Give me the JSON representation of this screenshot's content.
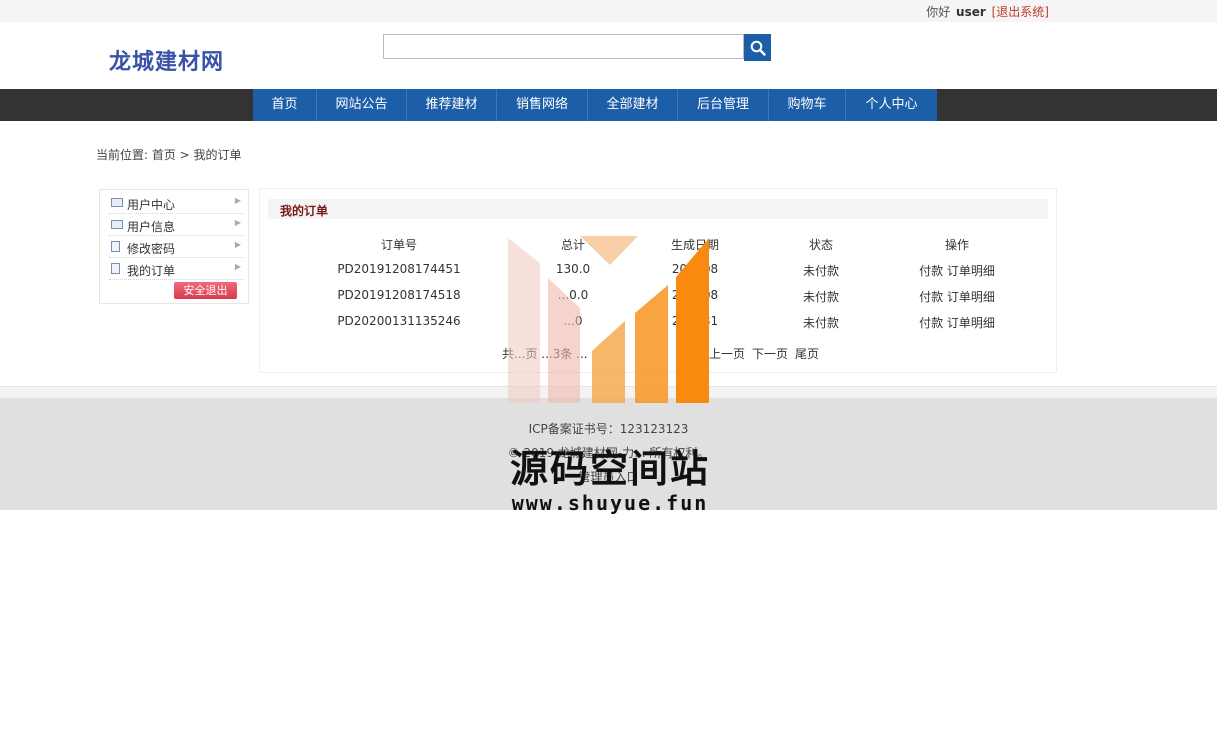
{
  "topbar": {
    "greeting": "你好",
    "username": "user",
    "logout": "[退出系统]"
  },
  "header": {
    "logo": "龙城建材网",
    "search_placeholder": ""
  },
  "nav": {
    "items": [
      "首页",
      "网站公告",
      "推荐建材",
      "销售网络",
      "全部建材",
      "后台管理",
      "购物车",
      "个人中心"
    ]
  },
  "breadcrumb": "当前位置: 首页 > 我的订单",
  "sidebar": {
    "items": [
      "用户中心",
      "用户信息",
      "修改密码",
      "我的订单"
    ],
    "logout_button": "安全退出"
  },
  "orders": {
    "title": "我的订单",
    "headers": [
      "订单号",
      "总计",
      "生成日期",
      "状态",
      "操作"
    ],
    "rows": [
      {
        "id": "PD20191208174451",
        "total": "130.0",
        "date": "20...-08",
        "status": "未付款",
        "pay": "付款",
        "detail": "订单明细"
      },
      {
        "id": "PD20191208174518",
        "total": "...0.0",
        "date": "20...-08",
        "status": "未付款",
        "pay": "付款",
        "detail": "订单明细"
      },
      {
        "id": "PD20200131135246",
        "total": "...0",
        "date": "20...-31",
        "status": "未付款",
        "pay": "付款",
        "detail": "订单明细"
      }
    ],
    "pager": {
      "summary": "共...页 ...3条 ...",
      "prev": "上一页",
      "next": "下一页",
      "last": "尾页"
    }
  },
  "footer": {
    "icp": "ICP备案证书号：123123123",
    "copyright": "© 2019 龙城建材网-力... 所有权利。",
    "admin": "管理员入口"
  },
  "watermark": {
    "title": "源码空间站",
    "url": "www.shuyue.fun"
  },
  "colors": {
    "nav_blue": "#1d5ea8",
    "nav_dark": "#333333",
    "logo": "#3a52a8",
    "logout_red": "#c0392b"
  }
}
